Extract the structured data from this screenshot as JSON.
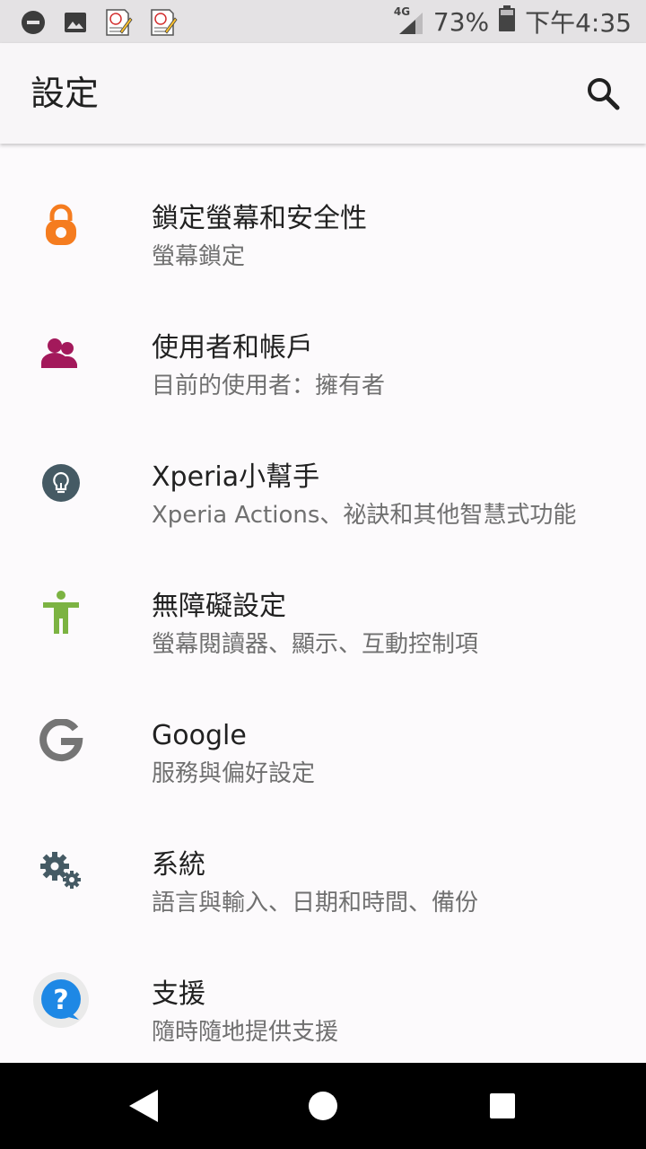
{
  "status_bar": {
    "network": "4G",
    "battery_percent": "73%",
    "time": "下午4:35",
    "notification_icons": [
      "dnd-icon",
      "image-icon",
      "note-app-icon",
      "note-app-icon"
    ]
  },
  "app_bar": {
    "title": "設定",
    "search_icon": "search-icon"
  },
  "settings_items": [
    {
      "title": "鎖定螢幕和安全性",
      "subtitle": "螢幕鎖定",
      "icon": "lock-icon",
      "color": "#f57c1f"
    },
    {
      "title": "使用者和帳戶",
      "subtitle": "目前的使用者：擁有者",
      "icon": "users-icon",
      "color": "#a3195b"
    },
    {
      "title": "Xperia小幫手",
      "subtitle": "Xperia Actions、祕訣和其他智慧式功能",
      "icon": "lightbulb-icon",
      "color": "#455a64"
    },
    {
      "title": "無障礙設定",
      "subtitle": "螢幕閱讀器、顯示、互動控制項",
      "icon": "accessibility-icon",
      "color": "#7cb342"
    },
    {
      "title": "Google",
      "subtitle": "服務與偏好設定",
      "icon": "google-icon",
      "color": "#757575"
    },
    {
      "title": "系統",
      "subtitle": "語言與輸入、日期和時間、備份",
      "icon": "gears-icon",
      "color": "#455a64"
    },
    {
      "title": "支援",
      "subtitle": "隨時隨地提供支援",
      "icon": "help-icon",
      "color": "#1e88e5"
    }
  ],
  "nav_bar": {
    "back": "back-icon",
    "home": "home-icon",
    "recents": "recents-icon"
  }
}
